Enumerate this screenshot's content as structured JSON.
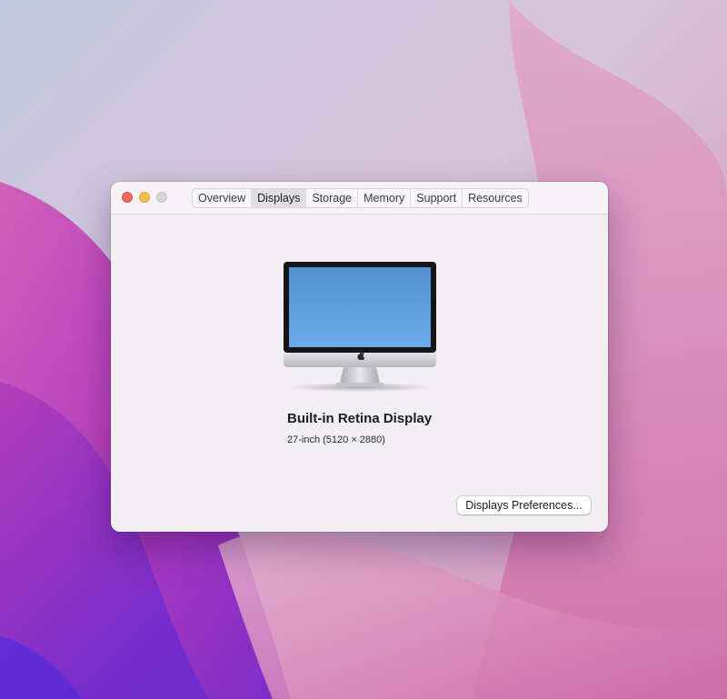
{
  "window": {
    "tabs": [
      {
        "label": "Overview",
        "active": false
      },
      {
        "label": "Displays",
        "active": true
      },
      {
        "label": "Storage",
        "active": false
      },
      {
        "label": "Memory",
        "active": false
      },
      {
        "label": "Support",
        "active": false
      },
      {
        "label": "Resources",
        "active": false
      }
    ]
  },
  "display": {
    "icon": "imac-icon",
    "name": "Built-in Retina Display",
    "spec": "27-inch (5120 × 2880)"
  },
  "actions": {
    "preferences_label": "Displays Preferences..."
  },
  "colors": {
    "close": "#ee6a5f",
    "minimize": "#f5be4f",
    "zoom_disabled": "#d9d6db",
    "screen_blue": "#5e9de0",
    "window_bg": "#f2eff3"
  }
}
